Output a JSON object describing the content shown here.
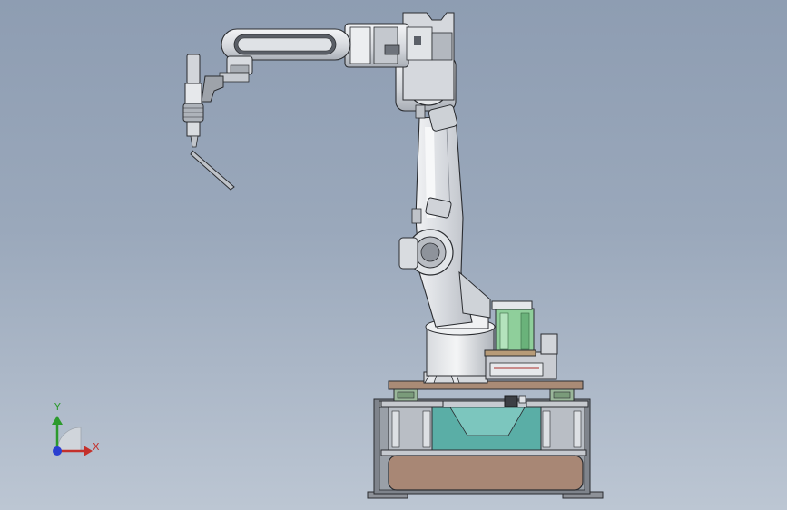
{
  "view": {
    "type": "cad-3d-viewport",
    "subject": "robot-arm-welding-assembly",
    "background_top": "#8e9db2",
    "background_bottom": "#bcc6d3"
  },
  "triad": {
    "y_label": "Y",
    "x_label": "X",
    "y_color": "#2c9a2c",
    "x_color": "#c4302b",
    "z_color": "#2a3fd0"
  },
  "colors": {
    "metal_light": "#e4e6ea",
    "metal_mid": "#c9ccd2",
    "metal_dark": "#5a5e66",
    "motor_green": "#8fcf9b",
    "frame_teal": "#5aaea6",
    "base_brown": "#a88775",
    "plate_brown": "#a98b76",
    "rail_green": "#9ab79a",
    "outline": "#2a2c30"
  }
}
